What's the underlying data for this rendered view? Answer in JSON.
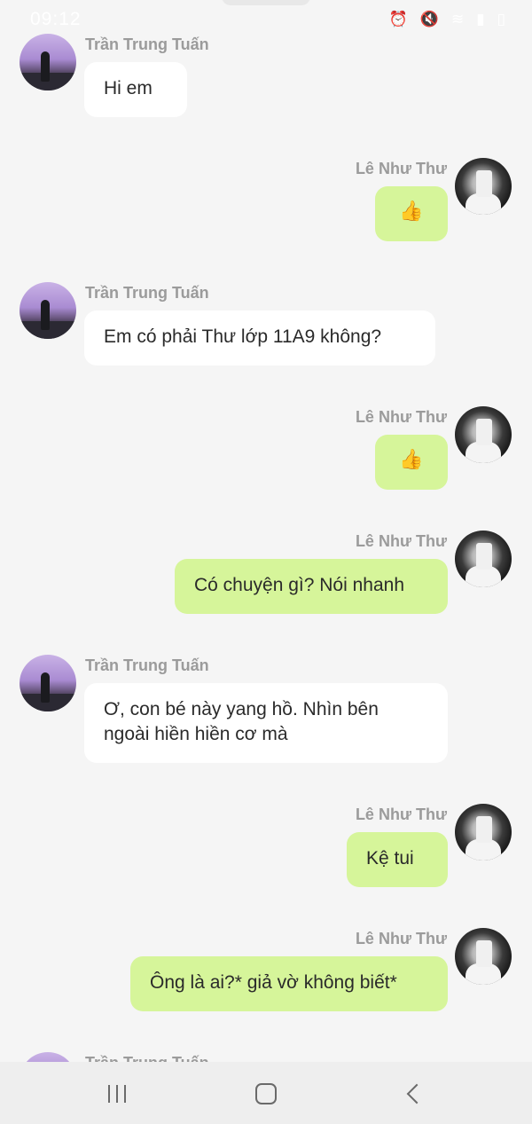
{
  "status_bar": {
    "time": "09:12",
    "icons": [
      "camera-icon",
      "alarm-icon",
      "mute-icon",
      "wifi-icon",
      "signal-icon",
      "battery-icon"
    ]
  },
  "messages": [
    {
      "sender": "Trần Trung Tuấn",
      "side": "left",
      "text": "Hi em"
    },
    {
      "sender": "Lê Như Thư",
      "side": "right",
      "text": "👍"
    },
    {
      "sender": "Trần Trung Tuấn",
      "side": "left",
      "text": "Em có phải Thư lớp 11A9 không?"
    },
    {
      "sender": "Lê Như Thư",
      "side": "right",
      "text": "👍"
    },
    {
      "sender": "Lê Như Thư",
      "side": "right",
      "text": "Có chuyện gì? Nói nhanh"
    },
    {
      "sender": "Trần Trung Tuấn",
      "side": "left",
      "text": "Ơ, con bé này yang hồ. Nhìn bên ngoài hiền hiền cơ mà"
    },
    {
      "sender": "Lê Như Thư",
      "side": "right",
      "text": "Kệ tui"
    },
    {
      "sender": "Lê Như Thư",
      "side": "right",
      "text": "Ông là ai?* giả vờ không biết*"
    },
    {
      "sender": "Trần Trung Tuấn",
      "side": "left",
      "text": ""
    }
  ],
  "colors": {
    "background": "#f5f5f5",
    "incoming_bubble": "#ffffff",
    "outgoing_bubble": "#d6f59a",
    "sender_name": "#9b9b9b",
    "nav_bar": "#eeeeee"
  },
  "nav_bar": {
    "icons": [
      "recents-icon",
      "home-icon",
      "back-icon"
    ]
  }
}
